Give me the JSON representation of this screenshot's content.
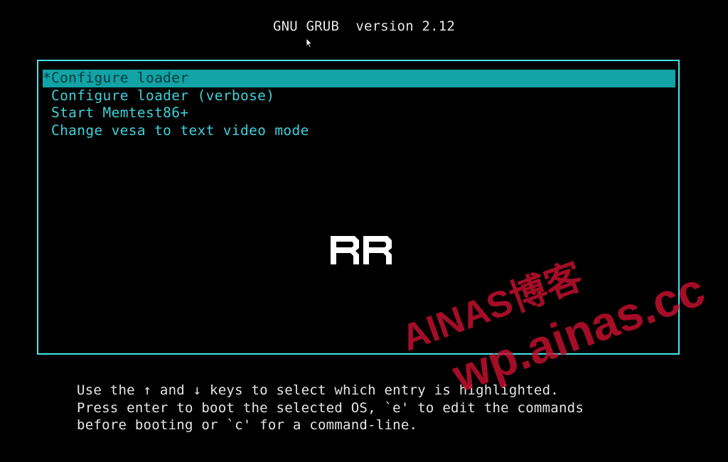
{
  "header": {
    "title": "GNU GRUB  version 2.12"
  },
  "menu": {
    "selected_marker": "*",
    "items": [
      {
        "label": "Configure loader",
        "selected": true
      },
      {
        "label": "Configure loader (verbose)",
        "selected": false
      },
      {
        "label": "Start Memtest86+",
        "selected": false
      },
      {
        "label": "Change vesa to text video mode",
        "selected": false
      }
    ]
  },
  "logo": {
    "text": "RR"
  },
  "help": {
    "line1": "Use the ↑ and ↓ keys to select which entry is highlighted.",
    "line2": "Press enter to boot the selected OS, `e' to edit the commands",
    "line3": "before booting or `c' for a command-line."
  },
  "watermark": {
    "line1": "AINAS博客",
    "line2": "wp.ainas.cc",
    "color": "#c8102e"
  },
  "colors": {
    "frame": "#45e5ea",
    "entry_text": "#3fd0d8",
    "selected_bg": "#11a3a6",
    "selected_text": "#003a3c",
    "text": "#e6e6e6",
    "background": "#000000"
  }
}
